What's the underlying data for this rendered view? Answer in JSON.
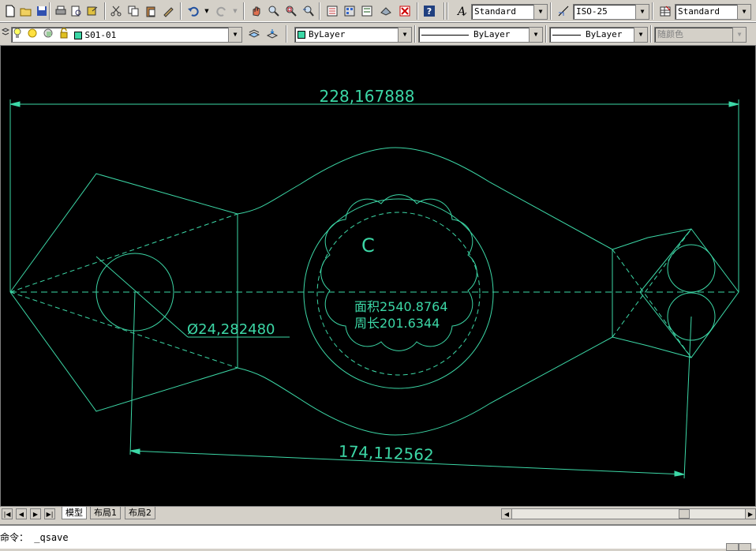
{
  "toolbar_top": {
    "text_style": "Standard",
    "dim_style": "ISO-25",
    "table_style": "Standard",
    "icons": [
      "new-icon",
      "open-icon",
      "save-icon",
      "print-icon",
      "preview-icon",
      "publish-icon",
      "cut-icon",
      "copy-icon",
      "paste-icon",
      "matchprop-icon",
      "undo-icon",
      "redo-icon",
      "pan-icon",
      "zoom-realtime-icon",
      "zoom-window-icon",
      "zoom-previous-icon",
      "properties-icon",
      "designcenter-icon",
      "toolpalette-icon",
      "sheetset-icon",
      "markup-icon",
      "help-icon"
    ]
  },
  "toolbar_layer": {
    "layer_name": "S01-01",
    "color": "ByLayer",
    "linetype": "ByLayer",
    "lineweight": "ByLayer",
    "plotstyle": "随颜色"
  },
  "drawing": {
    "dim_top": "228,167888",
    "dim_bottom": "174,112562",
    "dim_diameter": "Ø24,282480",
    "label_c": "C",
    "area_line": "面积2540.8764",
    "perimeter_line": "周长201.6344",
    "colors": {
      "background": "#000000",
      "geometry": "#3cd7a6"
    }
  },
  "tabs": {
    "model": "模型",
    "layout1": "布局1",
    "layout2": "布局2"
  },
  "command": {
    "prompt": "命令：",
    "value": "_qsave"
  }
}
